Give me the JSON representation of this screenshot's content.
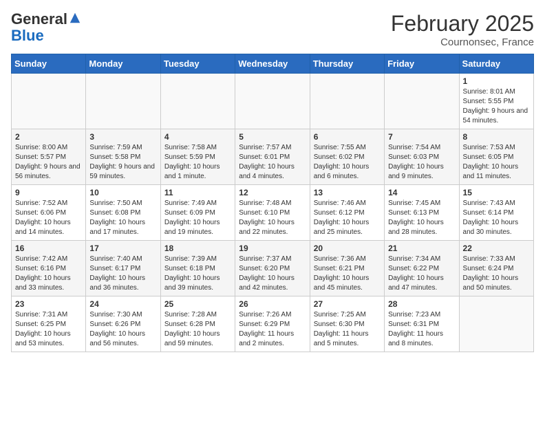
{
  "header": {
    "logo_general": "General",
    "logo_blue": "Blue",
    "month_title": "February 2025",
    "location": "Cournonsec, France"
  },
  "weekdays": [
    "Sunday",
    "Monday",
    "Tuesday",
    "Wednesday",
    "Thursday",
    "Friday",
    "Saturday"
  ],
  "weeks": [
    [
      {
        "day": "",
        "info": ""
      },
      {
        "day": "",
        "info": ""
      },
      {
        "day": "",
        "info": ""
      },
      {
        "day": "",
        "info": ""
      },
      {
        "day": "",
        "info": ""
      },
      {
        "day": "",
        "info": ""
      },
      {
        "day": "1",
        "info": "Sunrise: 8:01 AM\nSunset: 5:55 PM\nDaylight: 9 hours and 54 minutes."
      }
    ],
    [
      {
        "day": "2",
        "info": "Sunrise: 8:00 AM\nSunset: 5:57 PM\nDaylight: 9 hours and 56 minutes."
      },
      {
        "day": "3",
        "info": "Sunrise: 7:59 AM\nSunset: 5:58 PM\nDaylight: 9 hours and 59 minutes."
      },
      {
        "day": "4",
        "info": "Sunrise: 7:58 AM\nSunset: 5:59 PM\nDaylight: 10 hours and 1 minute."
      },
      {
        "day": "5",
        "info": "Sunrise: 7:57 AM\nSunset: 6:01 PM\nDaylight: 10 hours and 4 minutes."
      },
      {
        "day": "6",
        "info": "Sunrise: 7:55 AM\nSunset: 6:02 PM\nDaylight: 10 hours and 6 minutes."
      },
      {
        "day": "7",
        "info": "Sunrise: 7:54 AM\nSunset: 6:03 PM\nDaylight: 10 hours and 9 minutes."
      },
      {
        "day": "8",
        "info": "Sunrise: 7:53 AM\nSunset: 6:05 PM\nDaylight: 10 hours and 11 minutes."
      }
    ],
    [
      {
        "day": "9",
        "info": "Sunrise: 7:52 AM\nSunset: 6:06 PM\nDaylight: 10 hours and 14 minutes."
      },
      {
        "day": "10",
        "info": "Sunrise: 7:50 AM\nSunset: 6:08 PM\nDaylight: 10 hours and 17 minutes."
      },
      {
        "day": "11",
        "info": "Sunrise: 7:49 AM\nSunset: 6:09 PM\nDaylight: 10 hours and 19 minutes."
      },
      {
        "day": "12",
        "info": "Sunrise: 7:48 AM\nSunset: 6:10 PM\nDaylight: 10 hours and 22 minutes."
      },
      {
        "day": "13",
        "info": "Sunrise: 7:46 AM\nSunset: 6:12 PM\nDaylight: 10 hours and 25 minutes."
      },
      {
        "day": "14",
        "info": "Sunrise: 7:45 AM\nSunset: 6:13 PM\nDaylight: 10 hours and 28 minutes."
      },
      {
        "day": "15",
        "info": "Sunrise: 7:43 AM\nSunset: 6:14 PM\nDaylight: 10 hours and 30 minutes."
      }
    ],
    [
      {
        "day": "16",
        "info": "Sunrise: 7:42 AM\nSunset: 6:16 PM\nDaylight: 10 hours and 33 minutes."
      },
      {
        "day": "17",
        "info": "Sunrise: 7:40 AM\nSunset: 6:17 PM\nDaylight: 10 hours and 36 minutes."
      },
      {
        "day": "18",
        "info": "Sunrise: 7:39 AM\nSunset: 6:18 PM\nDaylight: 10 hours and 39 minutes."
      },
      {
        "day": "19",
        "info": "Sunrise: 7:37 AM\nSunset: 6:20 PM\nDaylight: 10 hours and 42 minutes."
      },
      {
        "day": "20",
        "info": "Sunrise: 7:36 AM\nSunset: 6:21 PM\nDaylight: 10 hours and 45 minutes."
      },
      {
        "day": "21",
        "info": "Sunrise: 7:34 AM\nSunset: 6:22 PM\nDaylight: 10 hours and 47 minutes."
      },
      {
        "day": "22",
        "info": "Sunrise: 7:33 AM\nSunset: 6:24 PM\nDaylight: 10 hours and 50 minutes."
      }
    ],
    [
      {
        "day": "23",
        "info": "Sunrise: 7:31 AM\nSunset: 6:25 PM\nDaylight: 10 hours and 53 minutes."
      },
      {
        "day": "24",
        "info": "Sunrise: 7:30 AM\nSunset: 6:26 PM\nDaylight: 10 hours and 56 minutes."
      },
      {
        "day": "25",
        "info": "Sunrise: 7:28 AM\nSunset: 6:28 PM\nDaylight: 10 hours and 59 minutes."
      },
      {
        "day": "26",
        "info": "Sunrise: 7:26 AM\nSunset: 6:29 PM\nDaylight: 11 hours and 2 minutes."
      },
      {
        "day": "27",
        "info": "Sunrise: 7:25 AM\nSunset: 6:30 PM\nDaylight: 11 hours and 5 minutes."
      },
      {
        "day": "28",
        "info": "Sunrise: 7:23 AM\nSunset: 6:31 PM\nDaylight: 11 hours and 8 minutes."
      },
      {
        "day": "",
        "info": ""
      }
    ]
  ]
}
